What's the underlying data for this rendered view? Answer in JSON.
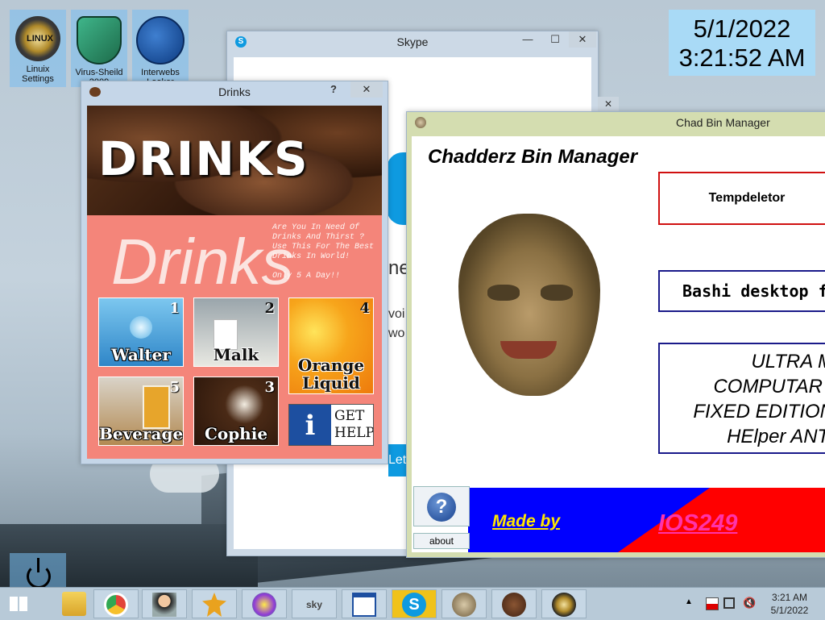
{
  "desktop": {
    "icons": [
      {
        "label": "Linuix\nSettings"
      },
      {
        "label": "Virus-Sheild\n2009"
      },
      {
        "label": "Interwebs\nLooker"
      }
    ],
    "clock": {
      "date": "5/1/2022",
      "time": "3:21:52 AM"
    }
  },
  "skype": {
    "title": "Skype",
    "minimize": "—",
    "maximize": "☐",
    "close": "✕",
    "partial_text_1": "ne",
    "partial_text_2": "voi",
    "partial_text_3": "wo",
    "partial_button": "Let"
  },
  "drinks": {
    "title": "Drinks",
    "help": "?",
    "close": "✕",
    "header": "DRINKS",
    "ghost_text": "Drinks",
    "blurb": "Are You In Need Of Drinks And Thirst ? Use This For The Best Drinks In World!",
    "price": "Only 5 A Day!!",
    "tiles": [
      {
        "label": "Walter",
        "num": "1"
      },
      {
        "label": "Malk",
        "num": "2"
      },
      {
        "label": "Orange Liquid",
        "num": "4"
      },
      {
        "label": "Beverage",
        "num": "5"
      },
      {
        "label": "Cophie",
        "num": "3"
      },
      {
        "label": "GET HELP",
        "num": ""
      }
    ]
  },
  "chad": {
    "title": "Chad Bin Manager",
    "heading": "Chadderz Bin Manager",
    "buttons": {
      "tempdeletor": "Tempdeletor",
      "bashi": "Bashi desktop fre",
      "ultra_lines": [
        "ULTRA M",
        "COMPUTAR",
        "FIXED EDITION",
        "HElper ANT-"
      ]
    },
    "help_icon": "?",
    "about": "about",
    "made_by": "Made by",
    "author": "IOS249",
    "colors": {
      "red": "#ff0000",
      "blue": "#0000ff",
      "yellow": "#ffe700",
      "pink": "#ff33aa"
    }
  },
  "taskbar": {
    "time": "3:21 AM",
    "date": "5/1/2022",
    "items": [
      "start-icon",
      "file-explorer-icon",
      "chrome-icon",
      "person-icon",
      "badge-icon",
      "purple-app-icon",
      "sky-app-icon",
      "window-app-icon",
      "skype-icon",
      "face-app-icon",
      "coffee-icon",
      "linuix-icon"
    ]
  }
}
